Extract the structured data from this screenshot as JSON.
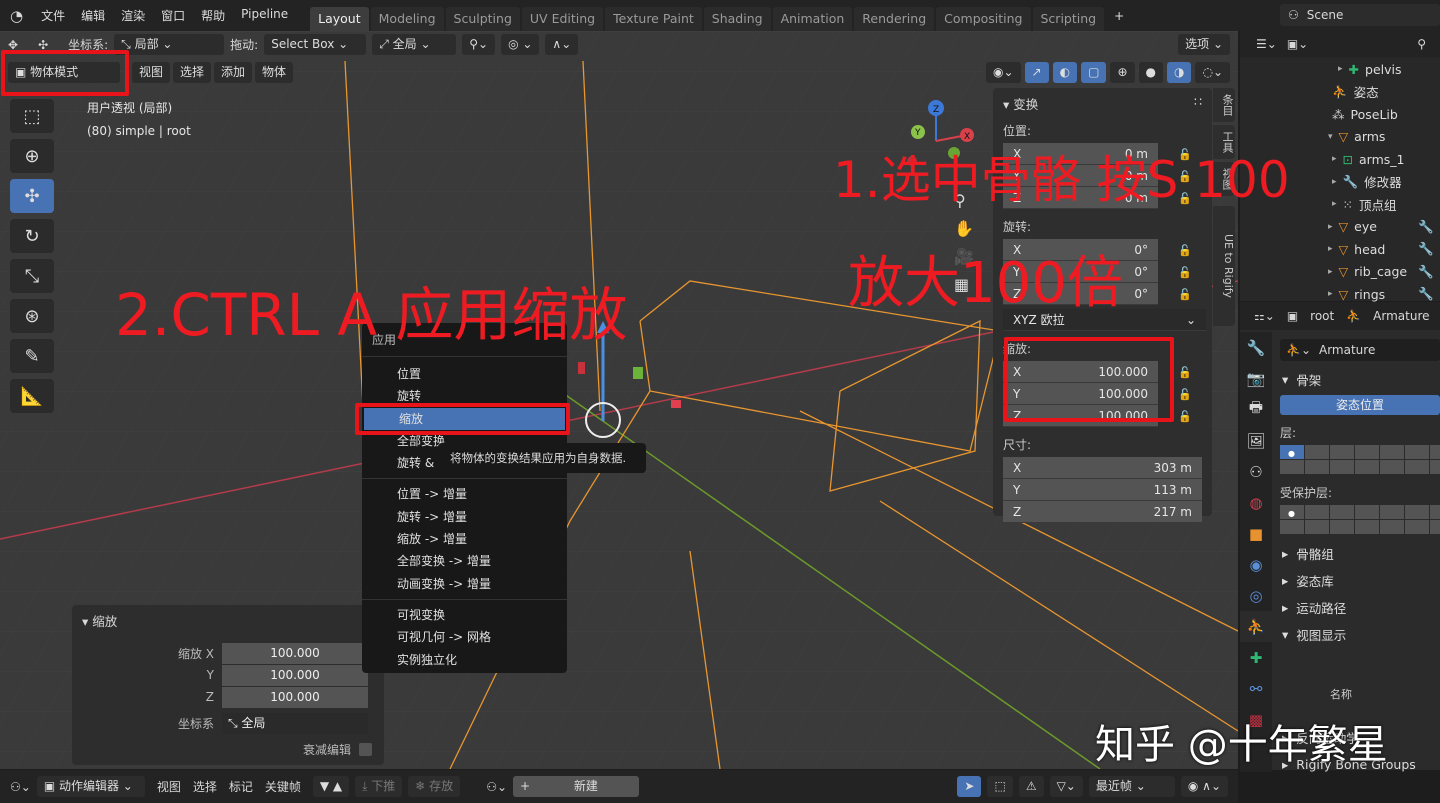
{
  "topbar": {
    "menus": [
      "文件",
      "编辑",
      "渲染",
      "窗口",
      "帮助",
      "Pipeline"
    ],
    "workspaces": [
      "Layout",
      "Modeling",
      "Sculpting",
      "UV Editing",
      "Texture Paint",
      "Shading",
      "Animation",
      "Rendering",
      "Compositing",
      "Scripting"
    ],
    "active_workspace": "Layout",
    "add_tab": "+",
    "scene": "Scene"
  },
  "viewport": {
    "header": {
      "coord_label": "坐标系:",
      "coord_value": "局部",
      "drag_label": "拖动:",
      "drag_value": "Select Box",
      "pivot_value": "全局",
      "options": "选项"
    },
    "mode": "物体模式",
    "menus": [
      "视图",
      "选择",
      "添加",
      "物体"
    ],
    "info_line1": "用户透视 (局部)",
    "info_line2": "(80) simple | root",
    "gizmo_axes": [
      "X",
      "Y",
      "Z"
    ]
  },
  "npanel": {
    "title": "变换",
    "location_label": "位置:",
    "location": [
      {
        "axis": "X",
        "value": "0 m"
      },
      {
        "axis": "Y",
        "value": "0 m"
      },
      {
        "axis": "Z",
        "value": "0 m"
      }
    ],
    "rotation_label": "旋转:",
    "rotation": [
      {
        "axis": "X",
        "value": "0°"
      },
      {
        "axis": "Y",
        "value": "0°"
      },
      {
        "axis": "Z",
        "value": "0°"
      }
    ],
    "rotation_mode": "XYZ 欧拉",
    "scale_label": "缩放:",
    "scale": [
      {
        "axis": "X",
        "value": "100.000"
      },
      {
        "axis": "Y",
        "value": "100.000"
      },
      {
        "axis": "Z",
        "value": "100.000"
      }
    ],
    "dimensions_label": "尺寸:",
    "dimensions": [
      {
        "axis": "X",
        "value": "303 m"
      },
      {
        "axis": "Y",
        "value": "113 m"
      },
      {
        "axis": "Z",
        "value": "217 m"
      }
    ],
    "tabs": [
      "条目",
      "工具",
      "视图",
      "UE to Rigify"
    ]
  },
  "outliner": {
    "items": [
      {
        "name": "pelvis",
        "icon": "bone-icon",
        "depth": 2
      },
      {
        "name": "姿态",
        "icon": "pose-icon",
        "depth": 1
      },
      {
        "name": "PoseLib",
        "icon": "poselib-icon",
        "depth": 1
      },
      {
        "name": "arms",
        "icon": "mesh-icon",
        "depth": 0
      },
      {
        "name": "arms_1",
        "icon": "mesh-data-icon",
        "depth": 1
      },
      {
        "name": "修改器",
        "icon": "wrench-icon",
        "depth": 1
      },
      {
        "name": "顶点组",
        "icon": "vertex-group-icon",
        "depth": 1
      },
      {
        "name": "eye",
        "icon": "mesh-icon",
        "depth": 0
      },
      {
        "name": "head",
        "icon": "mesh-icon",
        "depth": 0
      },
      {
        "name": "rib_cage",
        "icon": "mesh-icon",
        "depth": 0
      },
      {
        "name": "rings",
        "icon": "mesh-icon",
        "depth": 0
      }
    ]
  },
  "properties": {
    "object": "root",
    "data": "Armature",
    "datablock": "Armature",
    "skeleton_section": "骨架",
    "pose_position": "姿态位置",
    "layers_label": "层:",
    "protected_label": "受保护层:",
    "sections": [
      "骨骼组",
      "姿态库",
      "运动路径",
      "视图显示"
    ],
    "name_label": "名称",
    "ik_section": "反向运动学",
    "rigify_section": "Rigify Bone Groups"
  },
  "context_menu": {
    "title": "应用",
    "groups": [
      [
        "位置",
        "旋转",
        "缩放",
        "全部变换",
        "旋转 & 缩放"
      ],
      [
        "位置 -> 增量",
        "旋转 -> 增量",
        "缩放 -> 增量",
        "全部变换 -> 增量",
        "动画变换 -> 增量"
      ],
      [
        "可视变换",
        "可视几何 -> 网格",
        "实例独立化"
      ]
    ],
    "highlighted": "缩放",
    "tooltip": "将物体的变换结果应用为自身数据."
  },
  "last_operator": {
    "title": "缩放",
    "rows": [
      {
        "label": "缩放 X",
        "value": "100.000"
      },
      {
        "label": "Y",
        "value": "100.000"
      },
      {
        "label": "Z",
        "value": "100.000"
      }
    ],
    "orient_label": "坐标系",
    "orient_value": "全局",
    "falloff_label": "衰减编辑"
  },
  "timeline": {
    "editor": "动作编辑器",
    "menus": [
      "视图",
      "选择",
      "标记",
      "关键帧"
    ],
    "push_down": "下推",
    "stash": "存放",
    "new": "新建",
    "snap": "最近帧"
  },
  "annotations": {
    "step1_line1": "1.选中骨骼 按S 100",
    "step1_line2": "放大100倍",
    "step2": "2.CTRL A  应用缩放",
    "watermark": "知乎 @十年繁星"
  },
  "colors": {
    "accent": "#4772b3",
    "annotation_red": "#e8141a",
    "selection_orange": "#f0a030"
  }
}
